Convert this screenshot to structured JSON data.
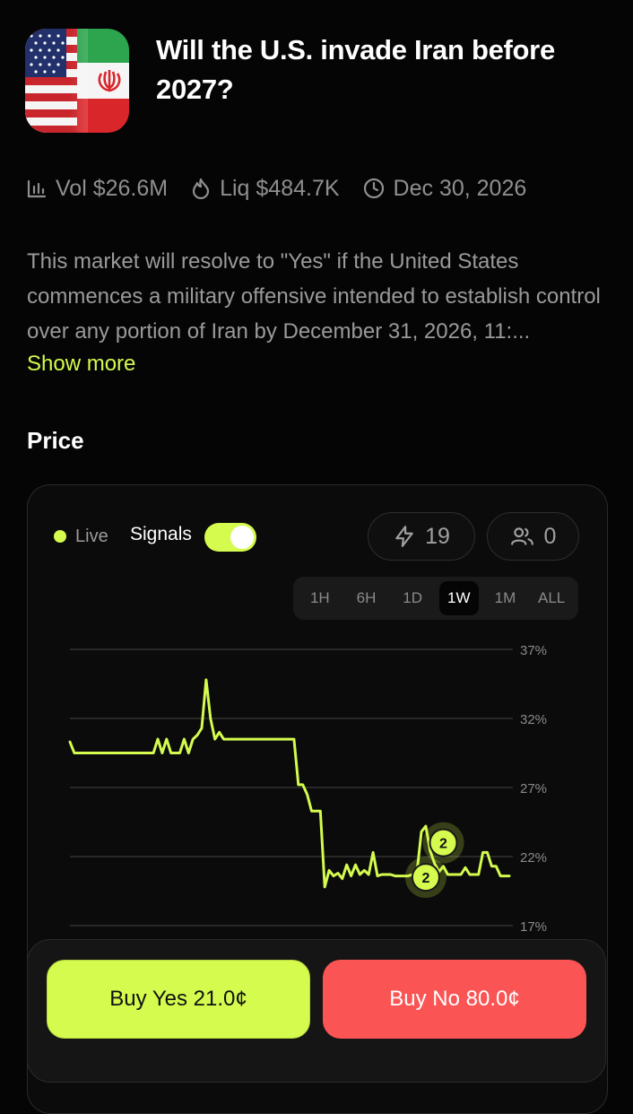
{
  "market": {
    "title": "Will the U.S. invade Iran before 2027?",
    "icon": "us-iran-flag-icon"
  },
  "stats": {
    "volume": "Vol $26.6M",
    "liquidity": "Liq $484.7K",
    "end_date": "Dec 30, 2026"
  },
  "description": {
    "text": "This market will resolve to \"Yes\" if the United States commences a military offensive intended to establish control over any portion of Iran by December 31, 2026, 11:...",
    "show_more": "Show more"
  },
  "price_section": {
    "title": "Price",
    "live_label": "Live",
    "signals_label": "Signals",
    "signals_enabled": true,
    "signals_count": "19",
    "users_count": "0",
    "timeframes": [
      "1H",
      "6H",
      "1D",
      "1W",
      "1M",
      "ALL"
    ],
    "active_timeframe": "1W"
  },
  "chart_data": {
    "type": "line",
    "y_ticks": [
      "37%",
      "32%",
      "27%",
      "22%",
      "17%"
    ],
    "ylim": [
      17,
      37
    ],
    "grid": true,
    "line_color": "#d4fb4e",
    "x": [
      0,
      1,
      2,
      3,
      4,
      5,
      6,
      7,
      8,
      9,
      10,
      11,
      12,
      13,
      14,
      15,
      16,
      17,
      18,
      19,
      20,
      21,
      22,
      23,
      24,
      25,
      26,
      27,
      28,
      29,
      30,
      31,
      32,
      33,
      34,
      35,
      36,
      37,
      38,
      39,
      40,
      41,
      42,
      43,
      44,
      45,
      46,
      47,
      48,
      49,
      50,
      51,
      52,
      53,
      54,
      55,
      56,
      57,
      58,
      59,
      60,
      61,
      62,
      63,
      64,
      65,
      66,
      67,
      68,
      69,
      70,
      71,
      72,
      73,
      74,
      75,
      76,
      77,
      78,
      79,
      80,
      81,
      82,
      83,
      84,
      85,
      86,
      87,
      88,
      89,
      90,
      91,
      92,
      93,
      94,
      95,
      96,
      97,
      98,
      99,
      100
    ],
    "values": [
      30.3,
      29.5,
      29.5,
      29.5,
      29.5,
      29.5,
      29.5,
      29.5,
      29.5,
      29.5,
      29.5,
      29.5,
      29.5,
      29.5,
      29.5,
      29.5,
      29.5,
      29.5,
      29.5,
      29.5,
      30.5,
      29.5,
      30.5,
      29.5,
      29.5,
      29.5,
      30.5,
      29.5,
      30.5,
      30.8,
      31.3,
      34.8,
      32.0,
      30.5,
      31.0,
      30.5,
      30.5,
      30.5,
      30.5,
      30.5,
      30.5,
      30.5,
      30.5,
      30.5,
      30.5,
      30.5,
      30.5,
      30.5,
      30.5,
      30.5,
      30.5,
      30.5,
      27.2,
      27.2,
      26.5,
      25.3,
      25.3,
      25.3,
      19.8,
      21.0,
      20.6,
      20.8,
      20.4,
      21.4,
      20.6,
      21.4,
      20.7,
      21.0,
      20.7,
      22.3,
      20.6,
      20.7,
      20.7,
      20.7,
      20.6,
      20.6,
      20.6,
      20.6,
      20.7,
      20.9,
      23.8,
      24.2,
      22.4,
      21.5,
      20.9,
      21.3,
      20.7,
      20.7,
      20.7,
      20.7,
      21.2,
      20.7,
      20.7,
      20.7,
      22.3,
      22.3,
      21.3,
      21.3,
      20.6,
      20.6,
      20.6
    ],
    "markers": [
      {
        "x": 85,
        "y": 23.0,
        "label": "2"
      },
      {
        "x": 81,
        "y": 20.5,
        "label": "2"
      }
    ]
  },
  "buy": {
    "yes_label": "Buy Yes 21.0¢",
    "no_label": "Buy No 80.0¢"
  },
  "colors": {
    "accent": "#d4fb4e",
    "no": "#fb5454",
    "background": "#050505"
  }
}
